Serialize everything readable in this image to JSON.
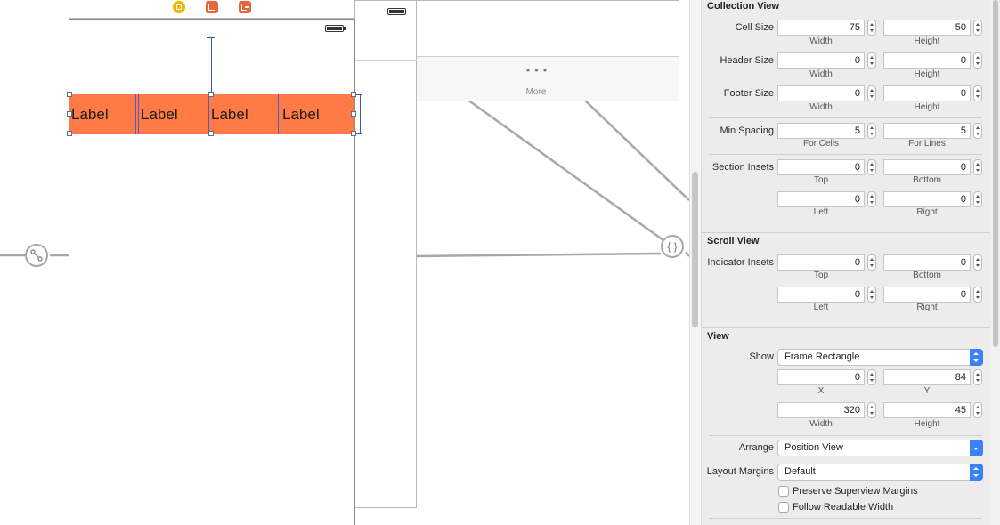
{
  "canvas": {
    "cell_labels": [
      "Label",
      "Label",
      "Label",
      "Label"
    ],
    "tabbar": {
      "more_dots": "• • •",
      "more_label": "More"
    },
    "segue_icon": "link-icon",
    "object_icon_text": "{ }",
    "colors": {
      "collection_bg": "#ff7a45",
      "selection": "#3d5b9b"
    }
  },
  "inspector": {
    "collection_view": {
      "title": "Collection View",
      "cell_size": {
        "label": "Cell Size",
        "width": "75",
        "height": "50",
        "width_label": "Width",
        "height_label": "Height"
      },
      "header_size": {
        "label": "Header Size",
        "width": "0",
        "height": "0",
        "width_label": "Width",
        "height_label": "Height"
      },
      "footer_size": {
        "label": "Footer Size",
        "width": "0",
        "height": "0",
        "width_label": "Width",
        "height_label": "Height"
      },
      "min_spacing": {
        "label": "Min Spacing",
        "cells": "5",
        "lines": "5",
        "cells_label": "For Cells",
        "lines_label": "For Lines"
      },
      "section_insets": {
        "label": "Section Insets",
        "top": "0",
        "bottom": "0",
        "left": "0",
        "right": "0",
        "top_label": "Top",
        "bottom_label": "Bottom",
        "left_label": "Left",
        "right_label": "Right"
      }
    },
    "scroll_view": {
      "title": "Scroll View",
      "indicator_insets": {
        "label": "Indicator Insets",
        "top": "0",
        "bottom": "0",
        "left": "0",
        "right": "0",
        "top_label": "Top",
        "bottom_label": "Bottom",
        "left_label": "Left",
        "right_label": "Right"
      }
    },
    "view": {
      "title": "View",
      "show": {
        "label": "Show",
        "value": "Frame Rectangle"
      },
      "frame": {
        "x": "0",
        "y": "84",
        "width": "320",
        "height": "45",
        "x_label": "X",
        "y_label": "Y",
        "width_label": "Width",
        "height_label": "Height"
      },
      "arrange": {
        "label": "Arrange",
        "value": "Position View"
      },
      "layout_margins": {
        "label": "Layout Margins",
        "value": "Default"
      },
      "preserve_superview_margins": "Preserve Superview Margins",
      "follow_readable_width": "Follow Readable Width"
    }
  }
}
